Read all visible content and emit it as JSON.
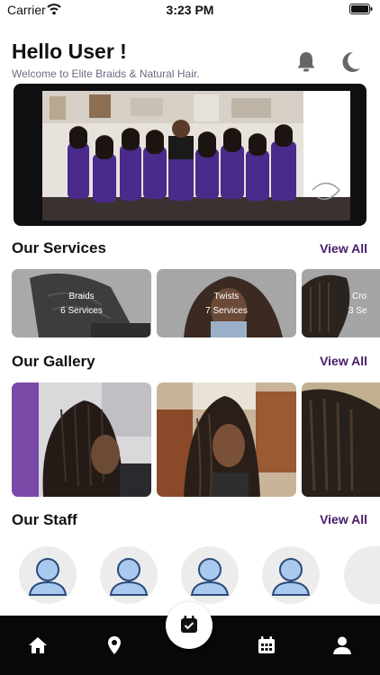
{
  "status_bar": {
    "carrier": "Carrier",
    "time": "3:23 PM"
  },
  "header": {
    "greeting": "Hello User !",
    "welcome": "Welcome to Elite Braids & Natural Hair."
  },
  "banner": {
    "dot_count": 3,
    "active_dot": 1
  },
  "services": {
    "title": "Our Services",
    "view_all": "View All",
    "items": [
      {
        "name": "Braids",
        "count": "6 Services"
      },
      {
        "name": "Twists",
        "count": "7 Services"
      },
      {
        "name": "Cro",
        "count": "3 Se"
      }
    ]
  },
  "gallery": {
    "title": "Our Gallery",
    "view_all": "View All"
  },
  "staff": {
    "title": "Our Staff",
    "view_all": "View All"
  },
  "tab_bar": {
    "icons": [
      "home-icon",
      "location-icon",
      "booking-icon",
      "calendar-icon",
      "profile-icon"
    ],
    "accent": "#4a1a6a",
    "background": "#080808"
  }
}
